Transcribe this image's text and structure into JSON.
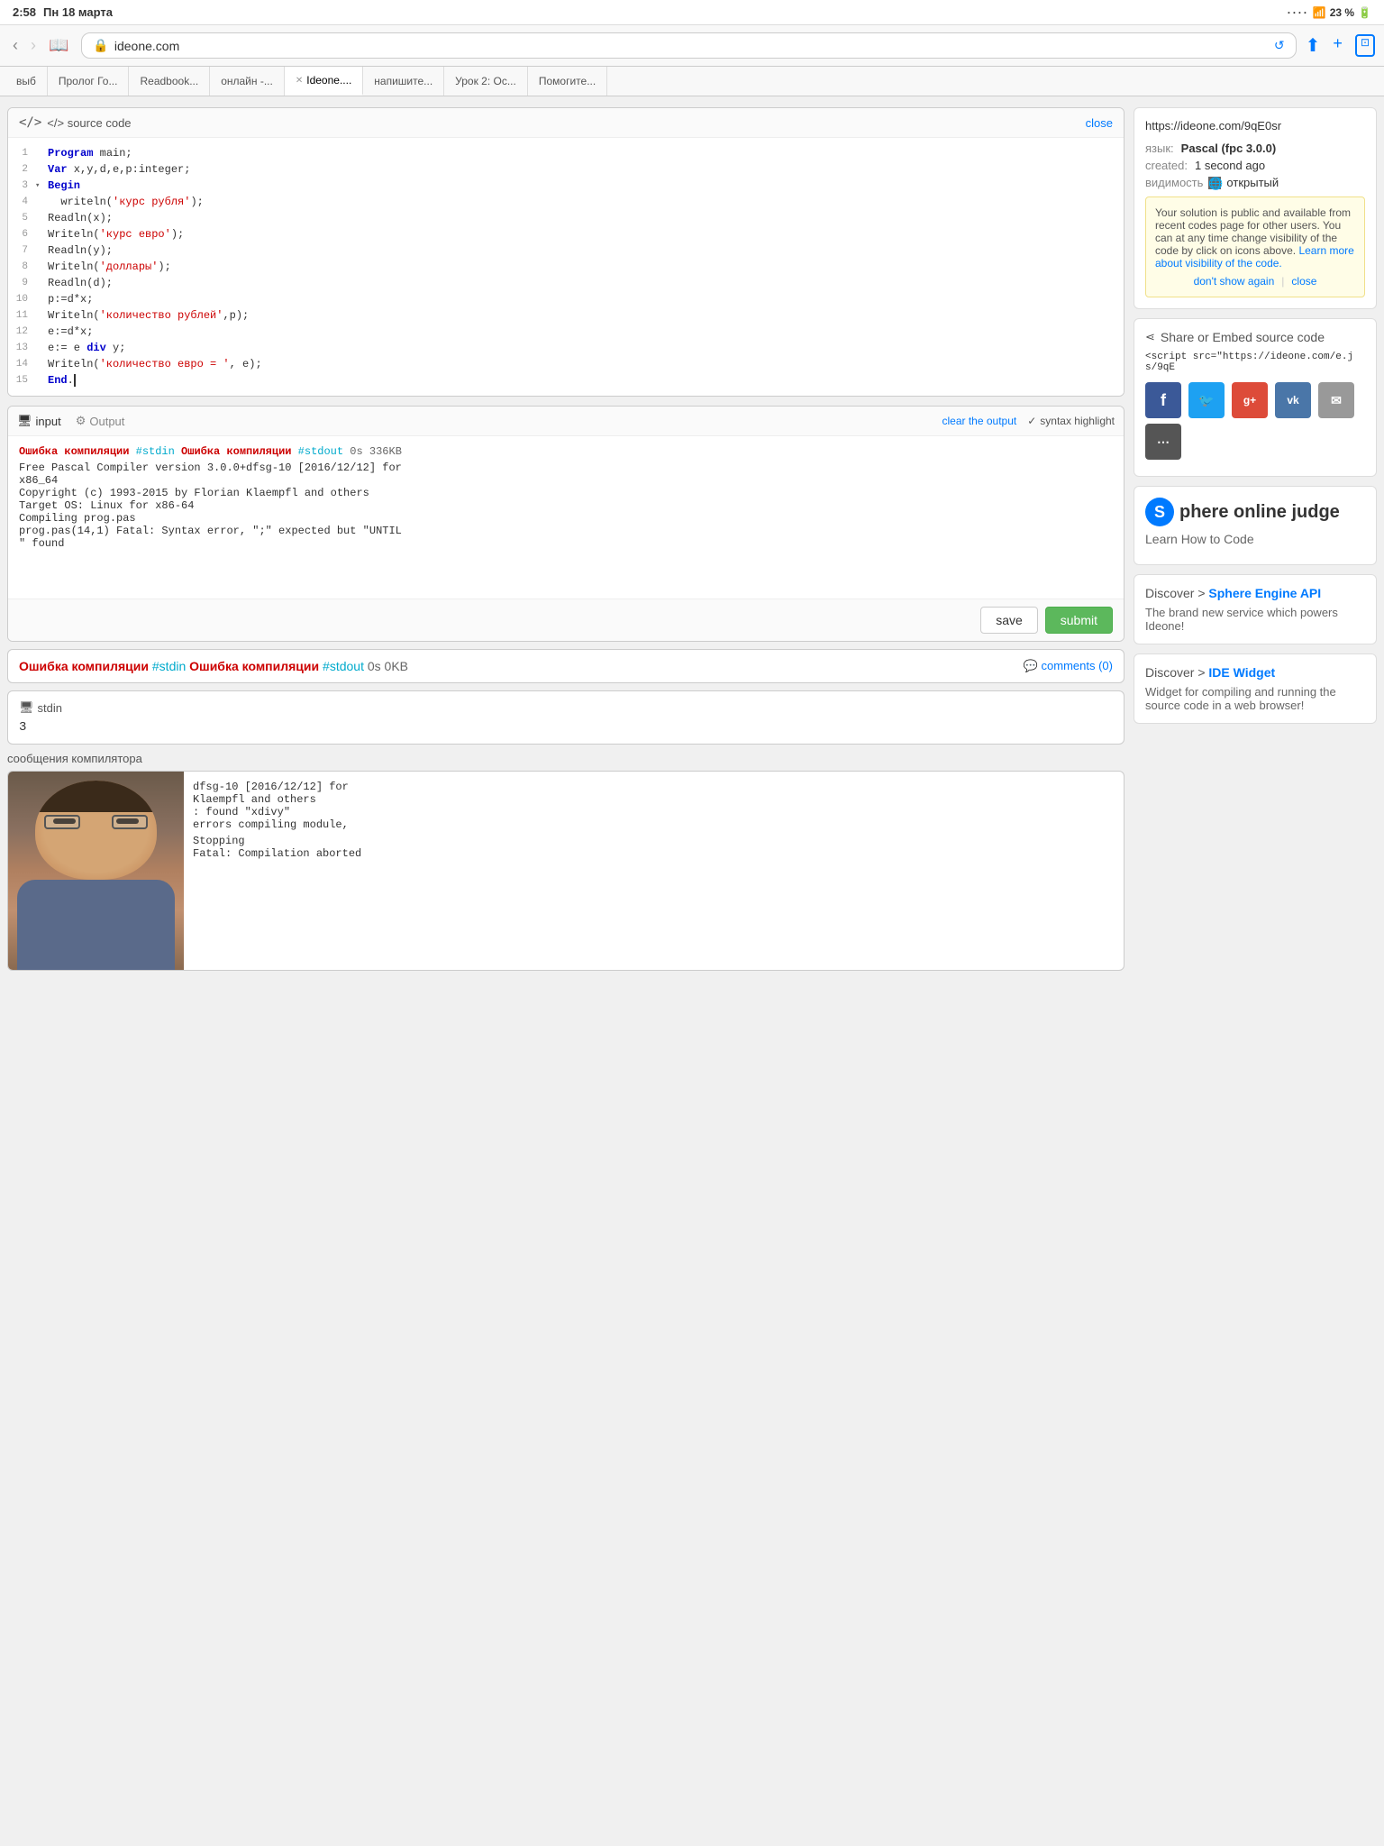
{
  "statusBar": {
    "time": "2:58",
    "dayInfo": "Пн 18 марта",
    "battery": "23 %",
    "signalDots": "····"
  },
  "browser": {
    "url": "ideone.com",
    "urlFull": "https://ideone.com/9qE0sr",
    "tabs": [
      {
        "label": "выб",
        "active": false
      },
      {
        "label": "Пролог Го...",
        "active": false
      },
      {
        "label": "Readbook...",
        "active": false
      },
      {
        "label": "онлайн -...",
        "active": false
      },
      {
        "label": "Ideone....",
        "active": true,
        "closeable": true
      },
      {
        "label": "напишите...",
        "active": false
      },
      {
        "label": "Урок 2: Ос...",
        "active": false
      },
      {
        "label": "Помогите...",
        "active": false
      }
    ]
  },
  "editor": {
    "title": "</> source code",
    "closeLabel": "close",
    "lines": [
      {
        "num": "1",
        "indicator": "",
        "code": "Program main;",
        "type": "normal"
      },
      {
        "num": "2",
        "indicator": "",
        "code": "Var x,y,d,e,p:integer;",
        "type": "normal"
      },
      {
        "num": "3",
        "indicator": "▾",
        "code": "Begin",
        "type": "keyword"
      },
      {
        "num": "4",
        "indicator": "",
        "code": "  writeln('курс рубля');",
        "type": "writeln"
      },
      {
        "num": "5",
        "indicator": "",
        "code": "Readln(x);",
        "type": "normal"
      },
      {
        "num": "6",
        "indicator": "",
        "code": "Writeln('курс евро');",
        "type": "writeln"
      },
      {
        "num": "7",
        "indicator": "",
        "code": "Readln(y);",
        "type": "normal"
      },
      {
        "num": "8",
        "indicator": "",
        "code": "Writeln('доллары');",
        "type": "writeln"
      },
      {
        "num": "9",
        "indicator": "",
        "code": "Readln(d);",
        "type": "normal"
      },
      {
        "num": "10",
        "indicator": "",
        "code": "p:=d*x;",
        "type": "normal"
      },
      {
        "num": "11",
        "indicator": "",
        "code": "Writeln('количество рублей',p);",
        "type": "writeln"
      },
      {
        "num": "12",
        "indicator": "",
        "code": "e:=d*x;",
        "type": "normal"
      },
      {
        "num": "13",
        "indicator": "",
        "code": "e:= e div y;",
        "type": "normal"
      },
      {
        "num": "14",
        "indicator": "",
        "code": "Writeln('количество евро = ', e);",
        "type": "writeln"
      },
      {
        "num": "15",
        "indicator": "",
        "code": "End.",
        "type": "keyword"
      }
    ]
  },
  "ioTabs": {
    "inputLabel": "input",
    "outputLabel": "Output",
    "clearLabel": "clear the output",
    "syntaxLabel": "syntax highlight"
  },
  "output": {
    "errorLine1": "Ошибка компиляции",
    "errorStdin1": "#stdin",
    "errorLabel1": "Ошибка компиляции",
    "errorStdout1": "#stdout",
    "errorTime1": "0s 336KB",
    "compilerText": "Free Pascal Compiler version 3.0.0+dfsg-10 [2016/12/12] for\nx86_64\nCopyright (c) 1993-2015 by Florian Klaempfl and others\nTarget OS: Linux for x86-64\nCompiling prog.pas\nprog.pas(14,1) Fatal: Syntax error, \";\" expected but \"UNTIL\n\" found"
  },
  "buttons": {
    "save": "save",
    "submit": "submit"
  },
  "errorSection": {
    "errorLine": "Ошибка компиляции",
    "stdinLabel": "#stdin",
    "errorLabel": "Ошибка компиляции",
    "stdoutLabel": "#stdout",
    "timeInfo": "0s 0KB",
    "commentsLabel": "comments (0)"
  },
  "stdin": {
    "label": "stdin",
    "value": "3"
  },
  "compilerSection": {
    "label": "сообщения компилятора",
    "text1": "dfsg-10 [2016/12/12] for",
    "text2": "Klaempfl and others",
    "text3": ": found \"xdivy\"",
    "text4": "errors compiling module,",
    "text5": "Stopping",
    "text6": "Fatal: Compilation aborted"
  },
  "rightPanel": {
    "urlDisplay": "https://ideone.com/9qE0sr",
    "languageLabel": "язык:",
    "languageValue": "Pascal (fpc 3.0.0)",
    "createdLabel": "created:",
    "createdValue": "1 second ago",
    "visibilityLabel": "видимость",
    "visibilityValue": "открытый",
    "notice": {
      "text": "Your solution is public and available from recent codes page for other users. You can at any time change visibility of the code by click on icons above.",
      "linkText": "Learn more about visibility of the code.",
      "dontShowLabel": "don't show again",
      "closeLabel": "close"
    },
    "shareTitle": "Share or Embed source code",
    "embedCode": "<script src=\"https://ideone.com/e.js/9qE",
    "socialButtons": [
      {
        "label": "f",
        "class": "fb",
        "name": "facebook"
      },
      {
        "label": "t",
        "class": "tw",
        "name": "twitter"
      },
      {
        "label": "g+",
        "class": "gp",
        "name": "google-plus"
      },
      {
        "label": "vk",
        "class": "vk",
        "name": "vkontakte"
      },
      {
        "label": "✉",
        "class": "em",
        "name": "email"
      },
      {
        "label": "⋯",
        "class": "sh",
        "name": "share"
      }
    ]
  },
  "sphere": {
    "logoLetter": "S",
    "title": "phere online judge",
    "subtitle": "Learn How to Code"
  },
  "discover1": {
    "prefix": "Discover > ",
    "linkText": "Sphere Engine API",
    "description": "The brand new service which powers Ideone!"
  },
  "discover2": {
    "prefix": "Discover > ",
    "linkText": "IDE Widget",
    "description": "Widget for compiling and running the source code in a web browser!"
  }
}
